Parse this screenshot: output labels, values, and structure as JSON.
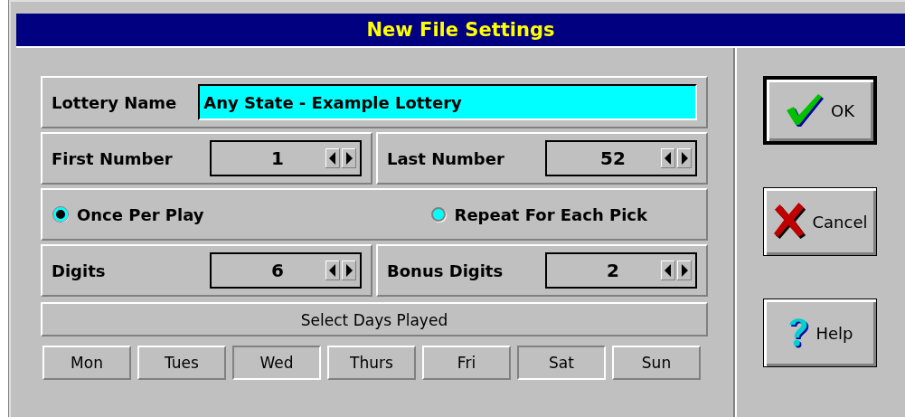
{
  "window": {
    "title": "New File Settings"
  },
  "lottery_name": {
    "label": "Lottery Name",
    "value": "Any State - Example Lottery"
  },
  "number_range": [
    {
      "label": "First Number",
      "value": "1"
    },
    {
      "label": "Last Number",
      "value": "52"
    }
  ],
  "play_mode": [
    {
      "label": "Once Per Play",
      "selected": true
    },
    {
      "label": "Repeat For Each Pick",
      "selected": false
    }
  ],
  "digits": [
    {
      "label": "Digits",
      "value": "6"
    },
    {
      "label": "Bonus Digits",
      "value": "2"
    }
  ],
  "days_header": "Select Days Played",
  "days": [
    {
      "label": "Mon",
      "selected": false
    },
    {
      "label": "Tues",
      "selected": false
    },
    {
      "label": "Wed",
      "selected": true
    },
    {
      "label": "Thurs",
      "selected": false
    },
    {
      "label": "Fri",
      "selected": false
    },
    {
      "label": "Sat",
      "selected": true
    },
    {
      "label": "Sun",
      "selected": false
    }
  ],
  "buttons": [
    {
      "kind": "ok",
      "label": "OK",
      "default": true
    },
    {
      "kind": "cancel",
      "label": "Cancel",
      "default": false
    },
    {
      "kind": "help",
      "label": "Help",
      "default": false
    }
  ]
}
